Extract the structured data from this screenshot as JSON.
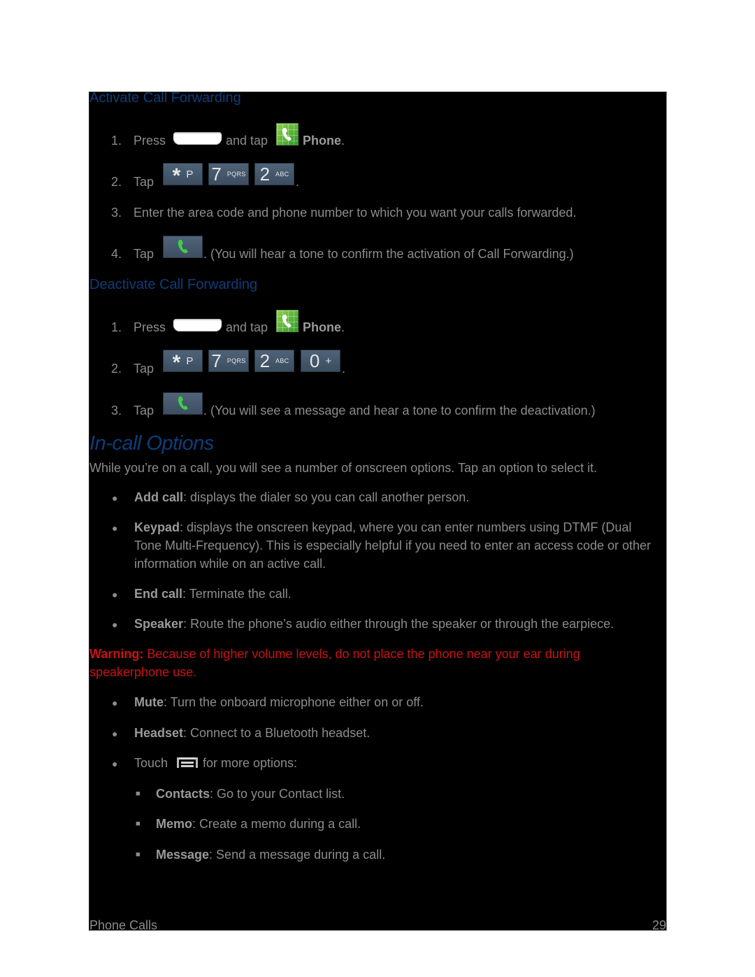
{
  "activate": {
    "heading": "Activate Call Forwarding",
    "steps": [
      {
        "num": "1.",
        "pre": "Press",
        "mid": "and tap",
        "bold": "Phone",
        "post": "."
      },
      {
        "num": "2.",
        "pre": "Tap",
        "post": "."
      },
      {
        "num": "3.",
        "text": "Enter the area code and phone number to which you want your calls forwarded."
      },
      {
        "num": "4.",
        "pre": "Tap",
        "post": ". (You will hear a tone to confirm the activation of Call Forwarding.)"
      }
    ]
  },
  "deactivate": {
    "heading": "Deactivate Call Forwarding",
    "steps": [
      {
        "num": "1.",
        "pre": "Press",
        "mid": "and tap",
        "bold": "Phone",
        "post": "."
      },
      {
        "num": "2.",
        "pre": "Tap",
        "post": "."
      },
      {
        "num": "3.",
        "pre": "Tap",
        "post": ". (You will see a message and hear a tone to confirm the deactivation.)"
      }
    ]
  },
  "keys": {
    "star": {
      "main": "*",
      "sub": "P"
    },
    "seven": {
      "main": "7",
      "sub": "PQRS"
    },
    "two": {
      "main": "2",
      "sub": "ABC"
    },
    "zero": {
      "main": "0",
      "sub": "+"
    }
  },
  "icons": {
    "home_key": "home-key-icon",
    "phone_app": "phone-app-icon",
    "call_key": "call-key-icon",
    "menu_key": "menu-key-icon"
  },
  "incall": {
    "heading": "In-call Options",
    "intro": "While you’re on a call, you will see a number of onscreen options. Tap an option to select it.",
    "options": [
      {
        "bold": "Add call",
        "text": ": displays the dialer so you can call another person."
      },
      {
        "bold": "Keypad",
        "text": ": displays the onscreen keypad, where you can enter numbers using DTMF (Dual Tone Multi-Frequency). This is especially helpful if you need to enter an access code or other information while on an active call."
      },
      {
        "bold": "End call",
        "text": ": Terminate the call."
      },
      {
        "bold": "Speaker",
        "text": ": Route the phone’s audio either through the speaker or through the earpiece."
      }
    ],
    "warning": {
      "label": "Warning:",
      "text": " Because of higher volume levels, do not place the phone near your ear during speakerphone use."
    },
    "options2": [
      {
        "bold": "Mute",
        "text": ": Turn the onboard microphone either on or off."
      },
      {
        "bold": "Headset",
        "text": ": Connect to a Bluetooth headset."
      }
    ],
    "touch": {
      "pre": "Touch",
      "post": "for more options:"
    },
    "menu_options": [
      {
        "bold": "Contacts",
        "text": ": Go to your Contact list."
      },
      {
        "bold": "Memo",
        "text": ": Create a memo during a call."
      },
      {
        "bold": "Message",
        "text": ": Send a message during a call."
      }
    ]
  },
  "footer": {
    "section": "Phone Calls",
    "page": "29"
  },
  "colors": {
    "heading": "#0d3d7a",
    "warning": "#cc1111",
    "body_text": "#8c8c8c",
    "background": "#000000"
  }
}
